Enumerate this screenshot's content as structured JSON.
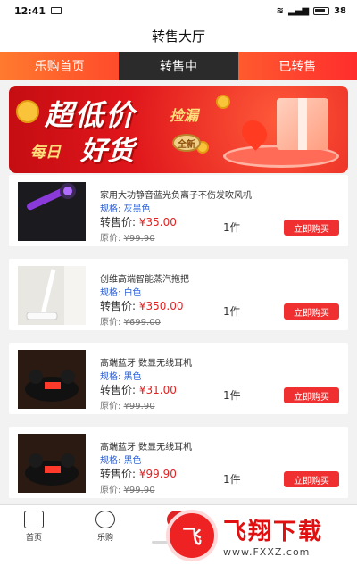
{
  "status": {
    "time": "12:41",
    "battery": "38"
  },
  "header": {
    "title": "转售大厅"
  },
  "tabs": [
    "乐购首页",
    "转售中",
    "已转售"
  ],
  "banner": {
    "headline": "超低价",
    "tag": "捡漏",
    "daily": "每日",
    "good": "好货",
    "badge": "全新"
  },
  "labels": {
    "spec": "规格:",
    "price": "转售价:",
    "original": "原价:",
    "buy": "立即购买"
  },
  "products": [
    {
      "name": "家用大功静音蓝光负离子不伤发吹风机",
      "spec": "灰黑色",
      "price": "¥35.00",
      "original": "¥99.90",
      "qty": "1件"
    },
    {
      "name": "创维高端智能蒸汽拖把",
      "spec": "白色",
      "price": "¥350.00",
      "original": "¥699.00",
      "qty": "1件"
    },
    {
      "name": "高端蓝牙 数显无线耳机",
      "spec": "黑色",
      "price": "¥31.00",
      "original": "¥99.90",
      "qty": "1件"
    },
    {
      "name": "高端蓝牙 数显无线耳机",
      "spec": "黑色",
      "price": "¥99.90",
      "original": "¥99.90",
      "qty": "1件"
    }
  ],
  "nav": [
    {
      "label": "首页",
      "icon": "home-icon"
    },
    {
      "label": "乐购",
      "icon": "shop-icon"
    },
    {
      "label": "",
      "icon": "resale-icon"
    }
  ],
  "watermark": {
    "brand": "飞翔下载",
    "url": "www.FXXZ.com"
  }
}
